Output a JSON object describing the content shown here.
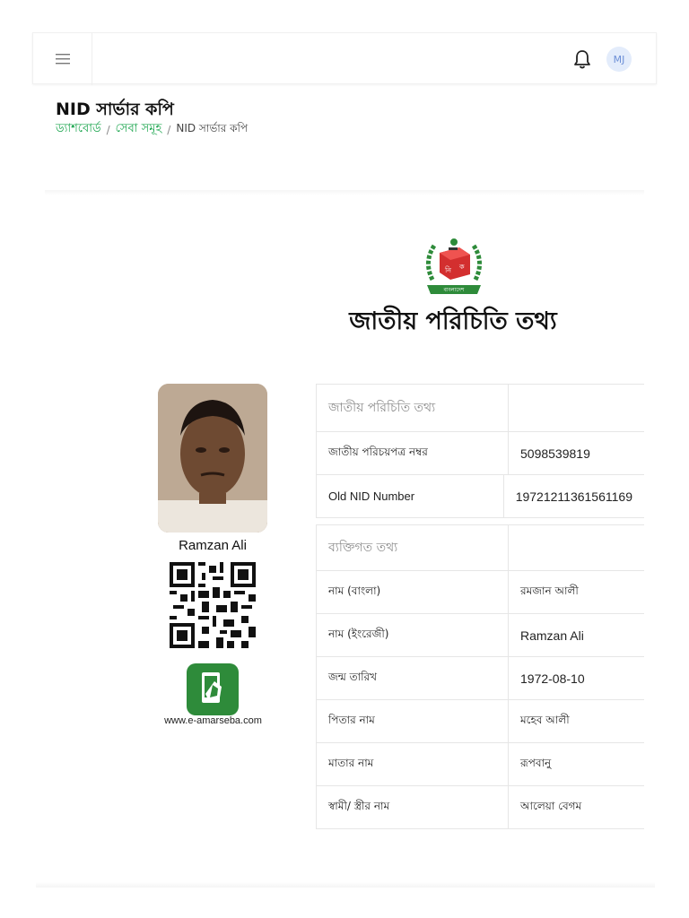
{
  "header": {
    "avatar_initials": "MJ"
  },
  "page": {
    "title": "NID সার্ভার কপি",
    "breadcrumb": [
      {
        "label": "ড্যাশবোর্ড",
        "link": true
      },
      {
        "label": "সেবা সমূহ",
        "link": true
      },
      {
        "label": "NID সার্ভার কপি",
        "link": false
      }
    ]
  },
  "card": {
    "heading": "জাতীয় পরিচিতি তথ্য",
    "logo_text": "বাংলাদেশ",
    "logo_letters": [
      "নি",
      "ক"
    ],
    "person_name": "Ramzan Ali",
    "website": "www.e-amarseba.com"
  },
  "table1": {
    "header": "জাতীয় পরিচিতি তথ্য",
    "rows": [
      {
        "key": "জাতীয় পরিচয়পত্র নম্বর",
        "value": "5098539819"
      },
      {
        "key": "Old NID Number",
        "value": "19721211361561169"
      }
    ]
  },
  "table2": {
    "header": "ব্যক্তিগত তথ্য",
    "rows": [
      {
        "key": "নাম (বাংলা)",
        "value": "রমজান আলী"
      },
      {
        "key": "নাম (ইংরেজী)",
        "value": "Ramzan Ali"
      },
      {
        "key": "জন্ম তারিখ",
        "value": "1972-08-10"
      },
      {
        "key": "পিতার নাম",
        "value": "মহেব আলী"
      },
      {
        "key": "মাতার নাম",
        "value": "রূপবানু"
      },
      {
        "key": "স্বামী/ স্ত্রীর নাম",
        "value": "আলেয়া বেগম"
      }
    ]
  },
  "colors": {
    "link_green": "#16a34a",
    "logo_green": "#2e8b3a",
    "logo_red": "#d32f2f"
  },
  "icons": [
    "menu-icon",
    "bell-icon",
    "election-commission-logo",
    "qr-code",
    "e-amarseba-app-icon"
  ]
}
